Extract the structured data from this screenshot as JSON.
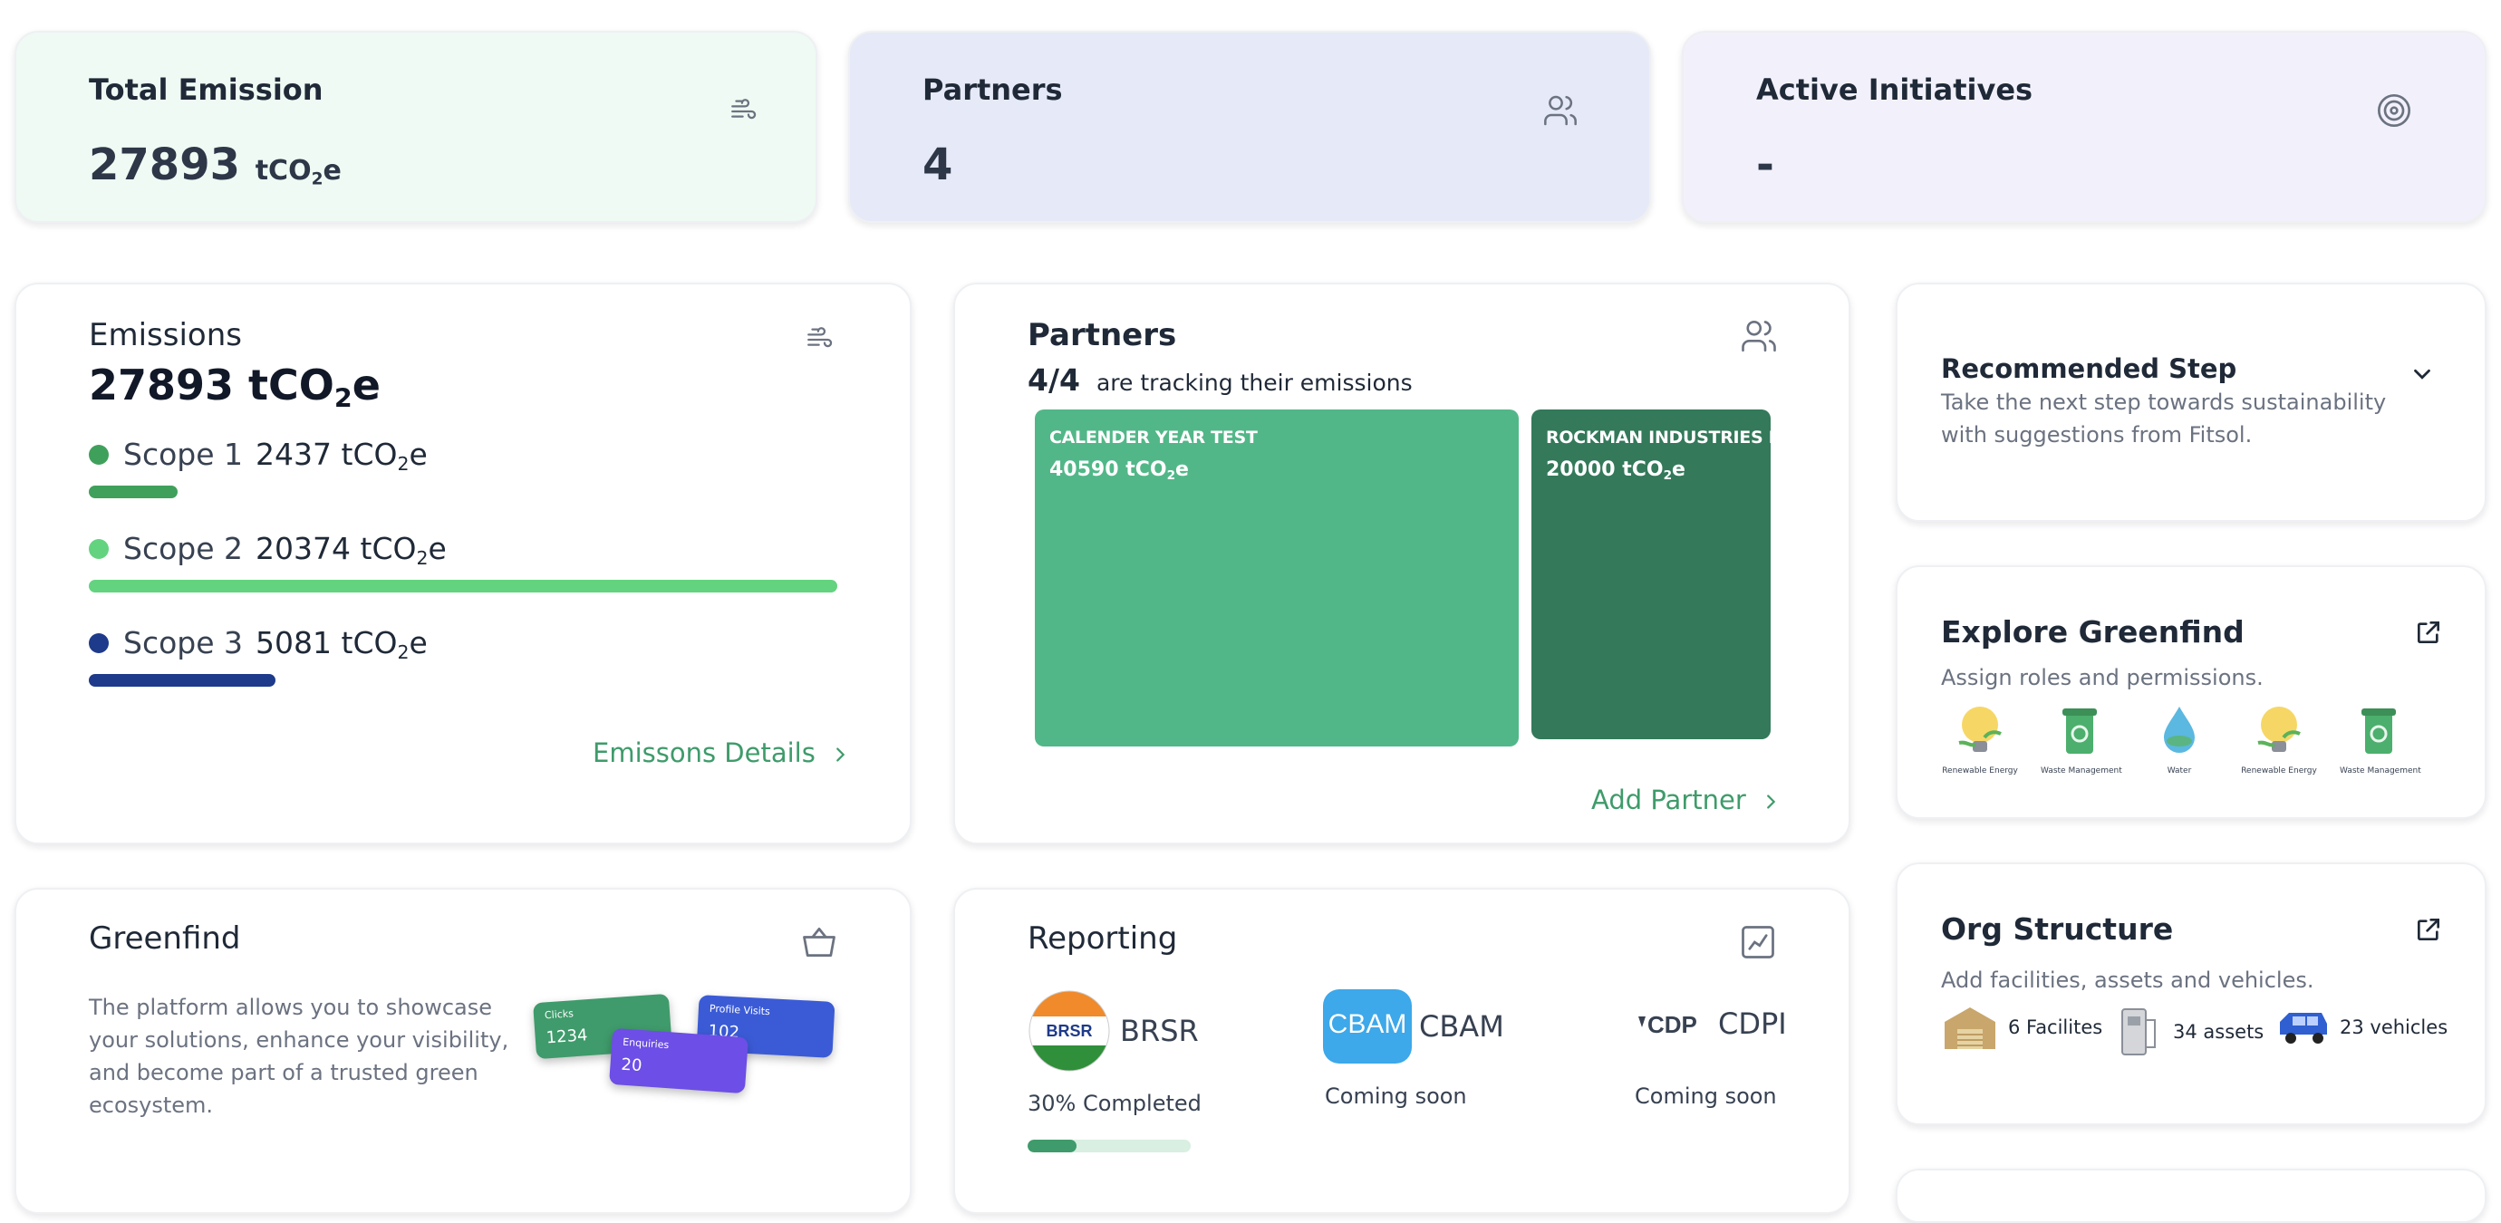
{
  "stats": [
    {
      "title": "Total Emission",
      "value": "27893",
      "unit_prefix": "tCO",
      "unit_sub": "2",
      "unit_suffix": "e",
      "icon": "wind-icon",
      "bg": "#eefaf3"
    },
    {
      "title": "Partners",
      "value": "4",
      "icon": "users-icon",
      "bg": "#e6e9f7"
    },
    {
      "title": "Active Initiatives",
      "value": "-",
      "icon": "target-icon",
      "bg": "#f2f1fb"
    }
  ],
  "emissions": {
    "title": "Emissions",
    "total_value": "27893 tCO",
    "total_sub": "2",
    "total_suffix": "e",
    "icon": "wind-icon",
    "scopes": [
      {
        "label": "Scope 1",
        "value": "2437 tCO",
        "sub": "2",
        "suffix": "e",
        "color": "#3fa05c",
        "share": 0.12
      },
      {
        "label": "Scope 2",
        "value": "20374 tCO",
        "sub": "2",
        "suffix": "e",
        "color": "#63d37f",
        "share": 1.0
      },
      {
        "label": "Scope 3",
        "value": "5081 tCO",
        "sub": "2",
        "suffix": "e",
        "color": "#1e3a8a",
        "share": 0.25
      }
    ],
    "details_link": "Emissons Details"
  },
  "partners": {
    "title": "Partners",
    "tracking_count": "4/4",
    "tracking_text": "are tracking their emissions",
    "icon": "users-icon",
    "tiles": [
      {
        "name": "CALENDER YEAR TEST",
        "value": "40590 tCO",
        "sub": "2",
        "suffix": "e",
        "color": "#52b788"
      },
      {
        "name": "ROCKMAN INDUSTRIES LIMITED",
        "value": "20000 tCO",
        "sub": "2",
        "suffix": "e",
        "color": "#33795a"
      }
    ],
    "add_link": "Add Partner"
  },
  "recommended": {
    "title": "Recommended Step",
    "desc_line1": "Take the next step towards sustainability",
    "desc_line2": "with suggestions from Fitsol.",
    "icon": "chevron-down-icon"
  },
  "explore": {
    "title": "Explore Greenfind",
    "desc": "Assign roles and permissions.",
    "icon": "external-link-icon",
    "categories": [
      {
        "label": "Renewable Energy",
        "icon": "lightbulb-icon"
      },
      {
        "label": "Waste Management",
        "icon": "recycle-bin-icon"
      },
      {
        "label": "Water",
        "icon": "water-drop-icon"
      },
      {
        "label": "Renewable Energy",
        "icon": "lightbulb-icon"
      },
      {
        "label": "Waste Management",
        "icon": "recycle-bin-icon"
      }
    ]
  },
  "org": {
    "title": "Org Structure",
    "desc": "Add facilities, assets and vehicles.",
    "icon": "external-link-icon",
    "items": [
      {
        "label": "6 Facilites",
        "icon": "warehouse-icon"
      },
      {
        "label": "34 assets",
        "icon": "machine-icon"
      },
      {
        "label": "23 vehicles",
        "icon": "van-icon"
      }
    ]
  },
  "greenfind": {
    "title": "Greenfind",
    "desc": "The platform allows you to showcase your solutions, enhance your visibility, and become part of a trusted green ecosystem.",
    "icon": "basket-icon",
    "mini_cards": [
      {
        "label": "Clicks",
        "value": "1234"
      },
      {
        "label": "Profile Visits",
        "value": "102"
      },
      {
        "label": "Enquiries",
        "value": "20"
      }
    ]
  },
  "reporting": {
    "title": "Reporting",
    "icon": "chart-icon",
    "items": [
      {
        "name": "BRSR",
        "logo_text": "BRSR",
        "status": "30% Completed",
        "progress": 0.3
      },
      {
        "name": "CBAM",
        "logo_text": "CBAM",
        "status": "Coming soon"
      },
      {
        "name": "CDPI",
        "logo_text": "CDP",
        "status": "Coming soon"
      }
    ]
  },
  "colors": {
    "accent_green": "#3f9b6b",
    "brand_dark": "#111827"
  }
}
